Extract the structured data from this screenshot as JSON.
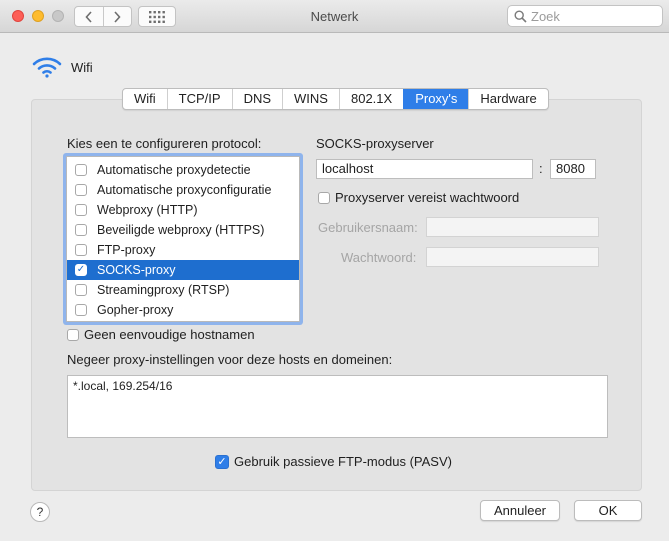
{
  "window": {
    "title": "Netwerk"
  },
  "search": {
    "placeholder": "Zoek"
  },
  "header": {
    "interface_label": "Wifi"
  },
  "tabs": [
    {
      "label": "Wifi",
      "active": false
    },
    {
      "label": "TCP/IP",
      "active": false
    },
    {
      "label": "DNS",
      "active": false
    },
    {
      "label": "WINS",
      "active": false
    },
    {
      "label": "802.1X",
      "active": false
    },
    {
      "label": "Proxy's",
      "active": true
    },
    {
      "label": "Hardware",
      "active": false
    }
  ],
  "protocols": {
    "heading": "Kies een te configureren protocol:",
    "items": [
      {
        "label": "Automatische proxydetectie",
        "checked": false,
        "selected": false
      },
      {
        "label": "Automatische proxyconfiguratie",
        "checked": false,
        "selected": false
      },
      {
        "label": "Webproxy (HTTP)",
        "checked": false,
        "selected": false
      },
      {
        "label": "Beveiligde webproxy (HTTPS)",
        "checked": false,
        "selected": false
      },
      {
        "label": "FTP-proxy",
        "checked": false,
        "selected": false
      },
      {
        "label": "SOCKS-proxy",
        "checked": true,
        "selected": true
      },
      {
        "label": "Streamingproxy (RTSP)",
        "checked": false,
        "selected": false
      },
      {
        "label": "Gopher-proxy",
        "checked": false,
        "selected": false
      }
    ]
  },
  "server": {
    "heading": "SOCKS-proxyserver",
    "host": "localhost",
    "separator": ":",
    "port": "8080",
    "requires_password_label": "Proxyserver vereist wachtwoord",
    "requires_password": false,
    "username_label": "Gebruikersnaam:",
    "password_label": "Wachtwoord:"
  },
  "simple_hostnames": {
    "label": "Geen eenvoudige hostnamen",
    "checked": false
  },
  "bypass": {
    "label": "Negeer proxy-instellingen voor deze hosts en domeinen:",
    "value": "*.local, 169.254/16"
  },
  "passive_ftp": {
    "label": "Gebruik passieve FTP-modus (PASV)",
    "checked": true
  },
  "footer": {
    "help_label": "?",
    "cancel_label": "Annuleer",
    "ok_label": "OK"
  },
  "colors": {
    "accent": "#2f7ee8",
    "selection": "#1e6ecf",
    "close": "#fd5f57",
    "minimize": "#febc2e"
  }
}
